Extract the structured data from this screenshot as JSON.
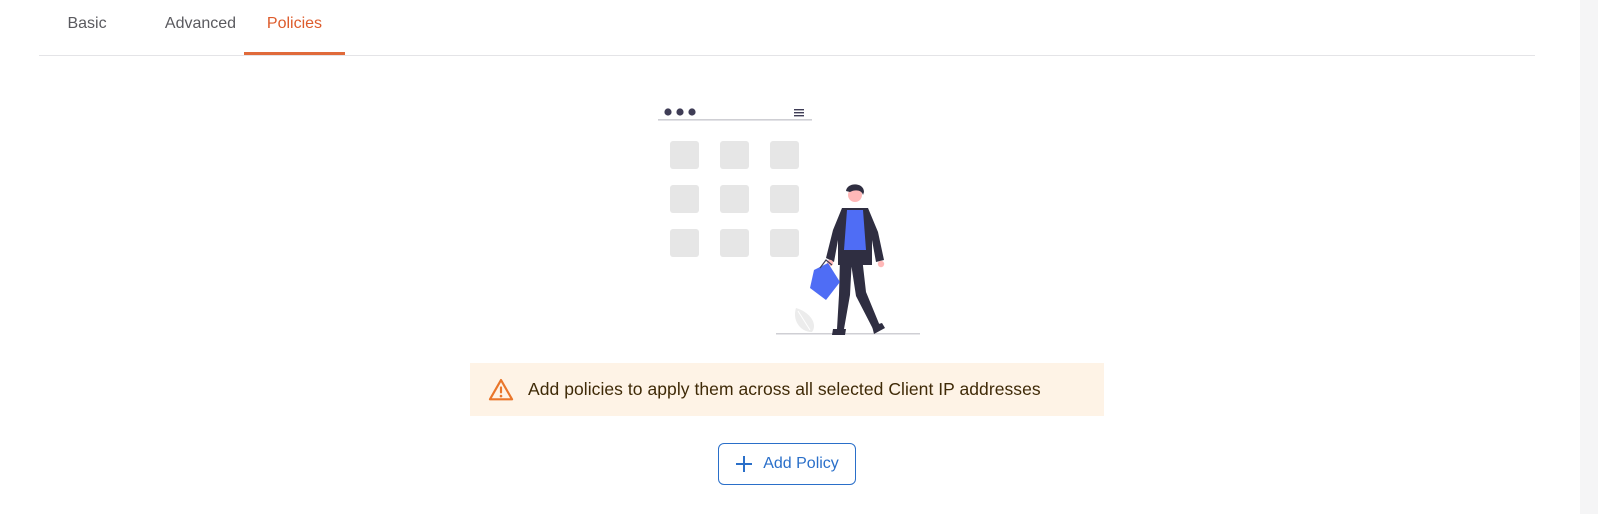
{
  "tabs": [
    {
      "label": "Basic",
      "active": false
    },
    {
      "label": "Advanced",
      "active": false
    },
    {
      "label": "Policies",
      "active": true
    }
  ],
  "empty_state": {
    "illustration": "person-walking-away-from-app-grid",
    "alert": {
      "icon": "warning-triangle-icon",
      "message": "Add policies to apply them across all selected Client IP addresses"
    },
    "add_button": {
      "icon": "plus-icon",
      "label": "Add Policy"
    }
  },
  "colors": {
    "active_tab": "#dd5b2b",
    "alert_bg": "#fef3e6",
    "warning": "#e9762b",
    "primary": "#2a6fc9",
    "figure_blue": "#4f6df5"
  }
}
